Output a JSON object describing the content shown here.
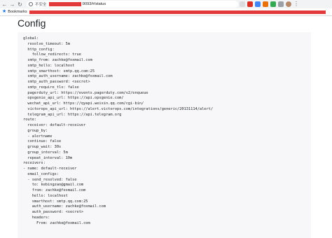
{
  "browser": {
    "insecure_label": "不安全",
    "url_suffix": ":9093/#/status",
    "bookmarks_label": "Bookmarks"
  },
  "page": {
    "title": "Config",
    "config_text": "global:\n  resolve_timeout: 5m\n  http_config:\n    follow_redirects: true\n  smtp_from: zachke@foxmail.com\n  smtp_hello: localhost\n  smtp_smarthost: smtp.qq.com:25\n  smtp_auth_username: zachke@foxmail.com\n  smtp_auth_password: <secret>\n  smtp_require_tls: false\n  pagerduty_url: https://events.pagerduty.com/v2/enqueue\n  opsgenie_api_url: https://api.opsgenie.com/\n  wechat_api_url: https://qyapi.weixin.qq.com/cgi-bin/\n  victorops_api_url: https://alert.victorops.com/integrations/generic/20131114/alert/\n  telegram_api_url: https://api.telegram.org\nroute:\n  receiver: default-receiver\n  group_by:\n  - alertname\n  continue: false\n  group_wait: 30s\n  group_interval: 5m\n  repeat_interval: 10m\nreceivers:\n- name: default-receiver\n  email_configs:\n  - send_resolved: false\n    to: kebingzao@gmail.com\n    from: zachke@foxmail.com\n    hello: localhost\n    smarthost: smtp.qq.com:25\n    auth_username: zachke@foxmail.com\n    auth_password: <secret>\n    headers:\n      From: zachke@foxmail.com"
  },
  "colors": {
    "redaction": "#e23a3a",
    "bookmark_star": "#1a73e8"
  }
}
